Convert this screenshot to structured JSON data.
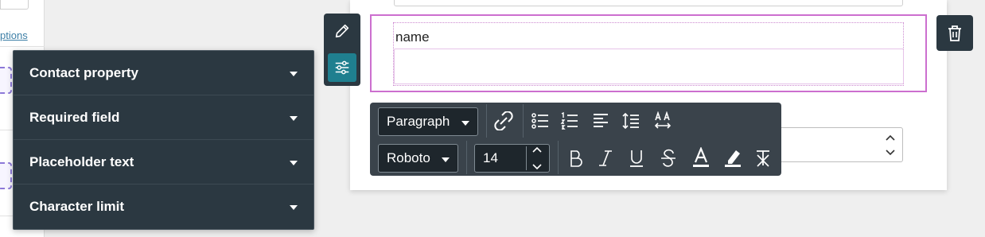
{
  "left_panel": {
    "link_text": "ptions"
  },
  "canvas": {
    "field_label": "name"
  },
  "settings_panel": {
    "items": [
      {
        "label": "Contact property"
      },
      {
        "label": "Required field"
      },
      {
        "label": "Placeholder text"
      },
      {
        "label": "Character limit"
      }
    ]
  },
  "toolbar": {
    "block_format": "Paragraph",
    "font_family": "Roboto",
    "font_size": "14"
  },
  "icons": {
    "side_tools": [
      "pencil-icon",
      "sliders-icon"
    ],
    "delete": "trash-icon",
    "toolbar_row1": [
      "unlink-icon",
      "bullet-list-icon",
      "numbered-list-icon",
      "align-left-icon",
      "line-height-icon",
      "letter-spacing-icon"
    ],
    "toolbar_row2": [
      "bold-icon",
      "italic-icon",
      "underline-icon",
      "strikethrough-icon",
      "text-color-icon",
      "highlight-icon",
      "clear-format-icon"
    ]
  },
  "colors": {
    "panel_bg": "#2b3841",
    "toolbar_bg": "#3a434b",
    "selection_border": "#cc6fcf",
    "active_tool": "#1f7f8f",
    "link": "#3d7fa6"
  }
}
